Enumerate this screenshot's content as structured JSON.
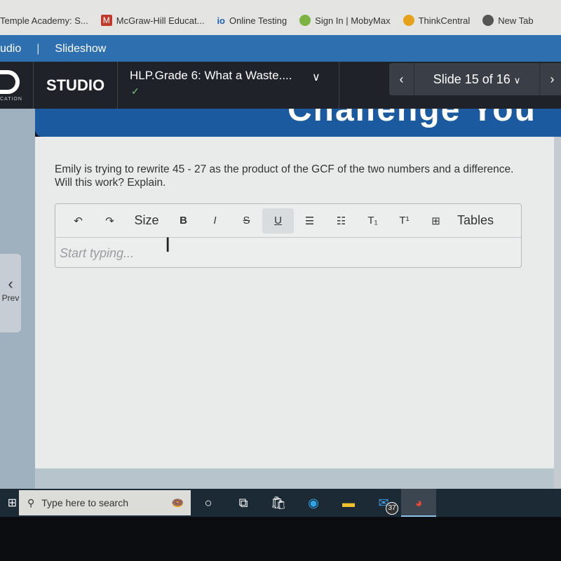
{
  "bookmarks": [
    {
      "label": "Temple Academy: S...",
      "icon": "school-icon",
      "color": "#e4e4e2"
    },
    {
      "label": "McGraw-Hill Educat...",
      "icon": "mcgraw-hill-icon",
      "color": "#c0392b"
    },
    {
      "label": "Online Testing",
      "icon": "io-icon",
      "color": "#1a5fb4"
    },
    {
      "label": "Sign In | MobyMax",
      "icon": "mobymax-icon",
      "color": "#7cb342"
    },
    {
      "label": "ThinkCentral",
      "icon": "thinkcentral-icon",
      "color": "#e6a21a"
    },
    {
      "label": "New Tab",
      "icon": "globe-icon",
      "color": "#555555"
    }
  ],
  "appbar": {
    "app": "udio",
    "section": "Slideshow"
  },
  "header": {
    "logo_caption": "CATION",
    "studio": "STUDIO",
    "title": "HLP.Grade 6: What a Waste....",
    "slide": "Slide 15 of 16"
  },
  "banner": {
    "title": "Challenge You"
  },
  "sidebar": {
    "prev": "Prev"
  },
  "question": "Emily is trying to rewrite 45 - 27 as the product of the GCF of the two numbers and a difference. Will this work? Explain.",
  "editor": {
    "toolbar": [
      "undo",
      "redo",
      "Size",
      "B",
      "I",
      "S",
      "U",
      "bullet-list",
      "numbered-list",
      "T₁",
      "T¹",
      "insert",
      "Tables"
    ],
    "size_label": "Size",
    "tables_label": "Tables",
    "placeholder": "Start typing..."
  },
  "taskbar": {
    "search_placeholder": "Type here to search",
    "mail_badge": "37"
  }
}
